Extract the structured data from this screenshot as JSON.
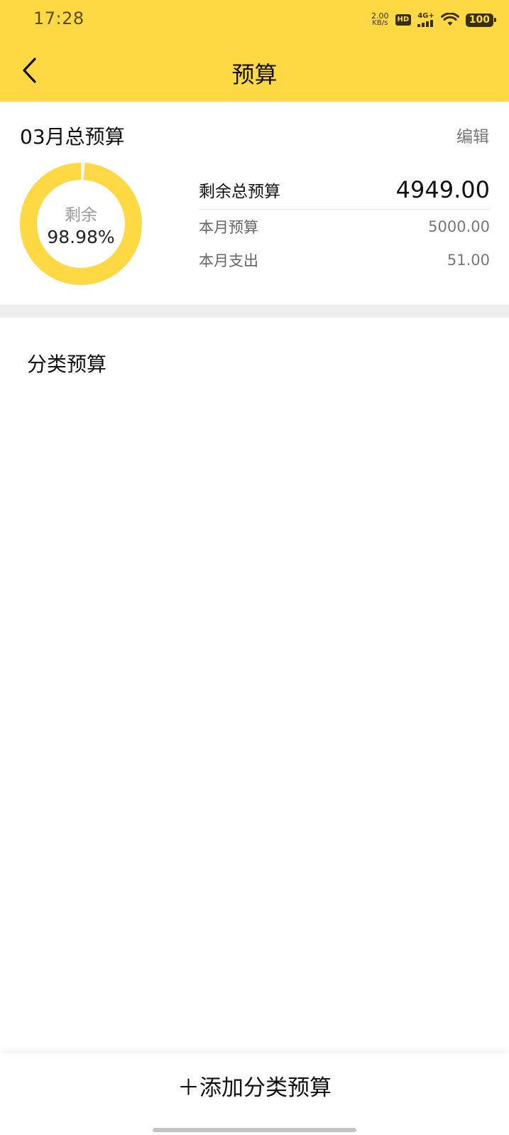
{
  "status_bar": {
    "time": "17:28",
    "net_speed_value": "2.00",
    "net_speed_unit": "KB/s",
    "hd_label": "HD",
    "signal_label": "4G+",
    "battery": "100"
  },
  "nav": {
    "title": "预算",
    "back_icon": "chevron-left-icon"
  },
  "summary": {
    "month_title": "03月总预算",
    "edit_label": "编辑",
    "donut": {
      "caption": "剩余",
      "percent_text": "98.98%",
      "remaining_fraction": 0.9898,
      "color_remaining": "#FFD944",
      "color_spent": "#F3F3F3"
    },
    "remaining_label": "剩余总预算",
    "remaining_value": "4949.00",
    "monthly_budget_label": "本月预算",
    "monthly_budget_value": "5000.00",
    "monthly_spend_label": "本月支出",
    "monthly_spend_value": "51.00"
  },
  "category_section": {
    "title": "分类预算"
  },
  "bottom": {
    "add_label": "＋添加分类预算"
  },
  "colors": {
    "accent": "#FFD944"
  }
}
